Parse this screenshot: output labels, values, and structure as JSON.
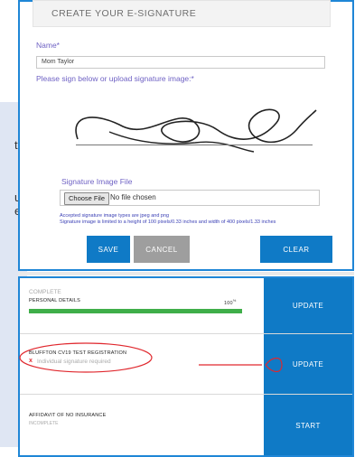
{
  "background": {
    "text_lines": [
      "t",
      "u",
      "e"
    ]
  },
  "form": {
    "title": "CREATE YOUR E-SIGNATURE",
    "name_label": "Name*",
    "name_value": "Mom Taylor",
    "sign_instruction": "Please sign below or upload signature image:*",
    "file_label": "Signature Image File",
    "choose_file_label": "Choose File",
    "no_file_text": "No file chosen",
    "note_line1": "Accepted signature image types are jpeg and png",
    "note_line2": "Signature image is limited to a height of 100 pixels/0.33 inches and width of 400 pixels/1.33 inches",
    "save_label": "SAVE",
    "cancel_label": "CANCEL",
    "clear_label": "CLEAR"
  },
  "steps": [
    {
      "status": "COMPLETE",
      "title": "PERSONAL DETAILS",
      "percent": "100",
      "percent_unit": "%",
      "progress": 1.0,
      "action": "UPDATE"
    },
    {
      "title": "BLUFFTON CV19 TEST REGISTRATION",
      "error_mark": "x",
      "error_text": "Individual signature required",
      "action": "UPDATE"
    },
    {
      "title": "AFFIDAVIT OF NO INSURANCE",
      "status": "INCOMPLETE",
      "action": "START"
    }
  ],
  "colors": {
    "primary": "#0f7ac6",
    "cancel": "#9e9e9e",
    "progress": "#3fae49",
    "annotation": "#e0282e",
    "label": "#6f62c4"
  }
}
